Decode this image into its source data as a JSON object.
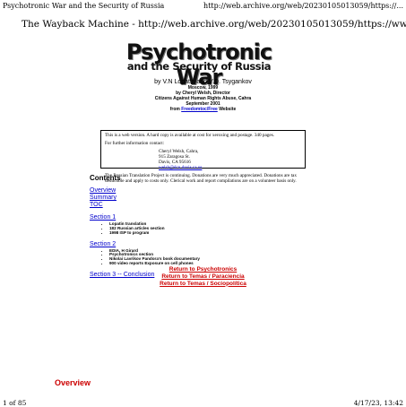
{
  "print_header": {
    "title": "Psychotronic War and the Security of Russia",
    "url": "http://web.archive.org/web/20230105013059/https://..."
  },
  "wayback_header": "The Wayback Machine - http://web.archive.org/web/20230105013059/https://ww...",
  "banner": {
    "line1": "Psychotronic War",
    "line2": "and the Security of Russia"
  },
  "byline": {
    "by": "by V.N Lopatin and V.D. Tsygankov",
    "place": "Moscow, 1999",
    "translator": "by Cheryl Welsh, Director",
    "org": "Citizens Against Human Rights Abuse, Cahra",
    "date": "September 2001",
    "from_prefix": "from",
    "from_link": "Freedomtoc/Free",
    "from_suffix": "Website"
  },
  "notice": {
    "p1": "This is a web version. A hard copy is available at cost for xeroxing and postage. 340 pages.",
    "p2": "For further information contact:",
    "address": [
      "Cheryl Welsh, Cahra,",
      "915 Zaragosa St.",
      "Davis, CA 95616"
    ],
    "email": "welsh@dcn.davis.ca.us",
    "p3": "The Russian Translation Project is continuing. Donations are very much appreciated. Donations are tax deductible and apply to costs only. Clerical work and report compilations are on a volunteer basis only."
  },
  "contents": {
    "title": "Contents",
    "top_links": [
      "Overview",
      "Summary",
      "TOC"
    ],
    "section1": {
      "label": "Section 1",
      "items": [
        "Lopatin translation",
        "182 Russian articles section",
        "1998 ISP to program"
      ]
    },
    "section2": {
      "label": "Section 2",
      "items": [
        "EDIA, H Girard",
        "Psychotronics section",
        "Nikolai Lavrikov Pandora's book documentary",
        "900 video reports Exposure on cell phones"
      ]
    },
    "section3": "Section 3 -- Conclusion"
  },
  "return_links": [
    "Return to Psychotronics",
    "Return to Temas / Paraciencia",
    "Return to Temas / Sociopolítica"
  ],
  "overview_heading": "Overview",
  "footer": {
    "page": "1 of 85",
    "datetime": "4/17/23, 13:42"
  }
}
